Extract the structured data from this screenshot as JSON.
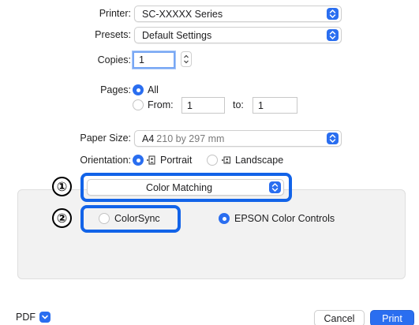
{
  "printer": {
    "label": "Printer:",
    "value": "SC-XXXXX Series"
  },
  "presets": {
    "label": "Presets:",
    "value": "Default Settings"
  },
  "copies": {
    "label": "Copies:",
    "value": "1"
  },
  "pages": {
    "label": "Pages:",
    "all_label": "All",
    "from_label": "From:",
    "from_value": "1",
    "to_label": "to:",
    "to_value": "1"
  },
  "paper_size": {
    "label": "Paper Size:",
    "value": "A4",
    "detail": "210 by 297 mm"
  },
  "orientation": {
    "label": "Orientation:",
    "portrait_label": "Portrait",
    "landscape_label": "Landscape"
  },
  "section_popup": {
    "value": "Color Matching"
  },
  "color_options": {
    "colorsync_label": "ColorSync",
    "epson_label": "EPSON Color Controls",
    "selected": "EPSON Color Controls"
  },
  "callouts": {
    "one": "①",
    "two": "②"
  },
  "footer": {
    "pdf_label": "PDF",
    "cancel_label": "Cancel",
    "print_label": "Print"
  },
  "colors": {
    "accent": "#2a6ef0",
    "highlight": "#1263e8"
  }
}
